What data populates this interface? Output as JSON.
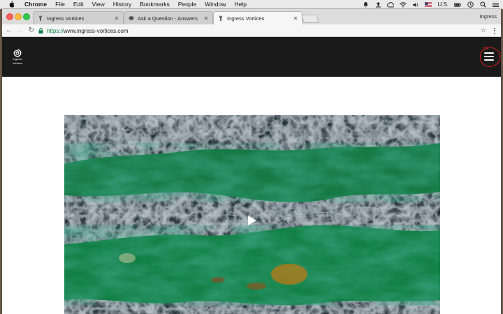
{
  "menubar": {
    "items": [
      "Chrome",
      "File",
      "Edit",
      "View",
      "History",
      "Bookmarks",
      "People",
      "Window",
      "Help"
    ],
    "input_source": "U.S.",
    "status_icons": [
      "bell-icon",
      "upload-icon",
      "creative-cloud-icon",
      "wifi-icon",
      "volume-icon",
      "flag-icon",
      "battery-icon",
      "clock-icon",
      "search-icon",
      "list-icon"
    ]
  },
  "browser": {
    "profile_name": "Ingress",
    "tabs": [
      {
        "title": "Ingress Vortices",
        "active": false
      },
      {
        "title": "Ask a Question - Answers",
        "active": false
      },
      {
        "title": "Ingress Vortices",
        "active": true
      }
    ],
    "url": {
      "scheme": "https://",
      "host": "www.ingress-vortices.com"
    }
  },
  "site": {
    "logo_text_line1": "Ingress",
    "logo_text_line2": "Vortices"
  },
  "colors": {
    "nav_background": "#1a1a1a",
    "annotation": "#e02020",
    "secure_green": "#0b8043"
  }
}
